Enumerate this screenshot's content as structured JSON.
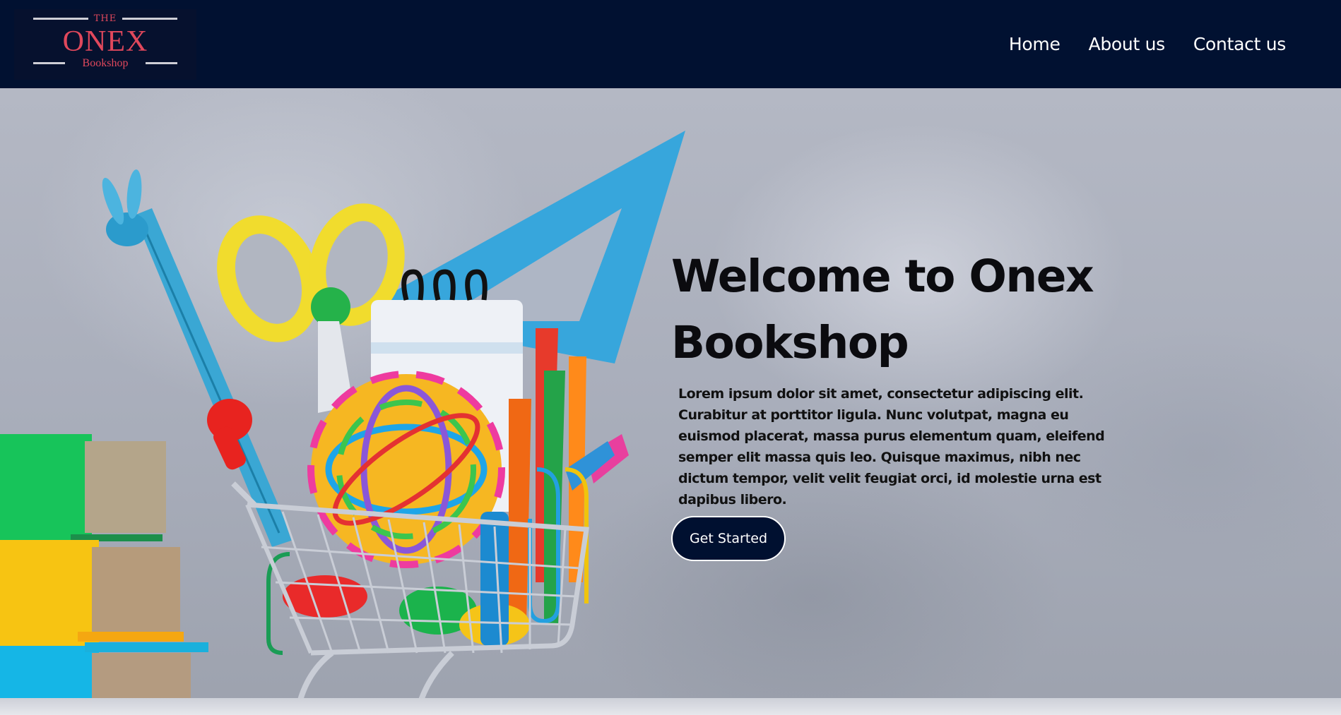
{
  "header": {
    "logo": {
      "top_text": "THE",
      "name": "ONEX",
      "subtitle": "Bookshop"
    },
    "nav": [
      "Home",
      "About us",
      "Contact us"
    ]
  },
  "hero": {
    "title": "Welcome to Onex Bookshop",
    "body": "Lorem ipsum dolor sit amet, consectetur adipiscing elit. Curabitur at porttitor ligula. Nunc volutpat, magna eu euismod placerat, massa purus elementum quam, eleifend semper elit massa quis leo. Quisque maximus, nibh nec dictum tempor, velit velit feugiat orci, id molestie urna est dapibus libero.",
    "cta_label": "Get Started"
  },
  "colors": {
    "nav_background": "#011131",
    "logo_accent": "#e0485c",
    "cta_background": "#001030",
    "nav_text": "#ffffff"
  }
}
